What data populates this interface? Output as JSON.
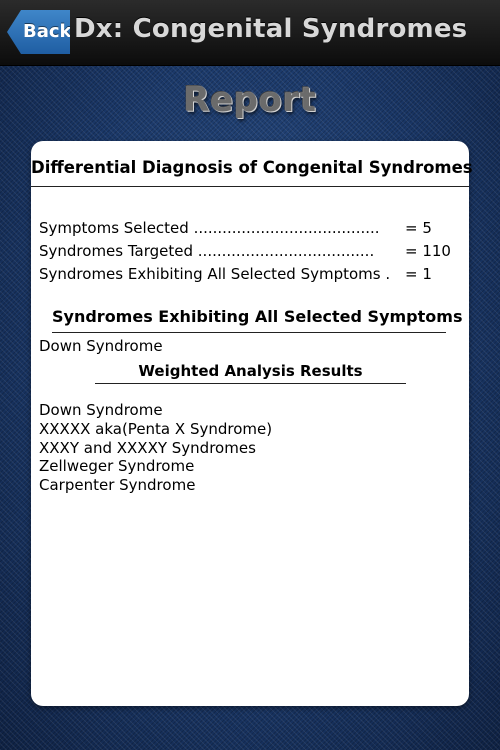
{
  "navbar": {
    "back_label": "Back",
    "title": "Dx: Congenital Syndromes"
  },
  "page": {
    "heading": "Report"
  },
  "report": {
    "title": "Differential Diagnosis of Congenital Syndromes",
    "stats": [
      {
        "label": "Symptoms Selected .......................................",
        "value": "= 5"
      },
      {
        "label": "Syndromes Targeted .....................................",
        "value": "= 110"
      },
      {
        "label": "Syndromes Exhibiting All Selected Symptoms .",
        "value": "= 1"
      }
    ],
    "all_symptoms_heading": "Syndromes Exhibiting All Selected Symptoms",
    "all_symptoms_list": [
      "Down Syndrome"
    ],
    "weighted_heading": "Weighted Analysis Results",
    "weighted_list": [
      "Down Syndrome",
      "XXXXX aka(Penta X Syndrome)",
      "XXXY and XXXXY Syndromes",
      "Zellweger Syndrome",
      "Carpenter Syndrome"
    ]
  }
}
